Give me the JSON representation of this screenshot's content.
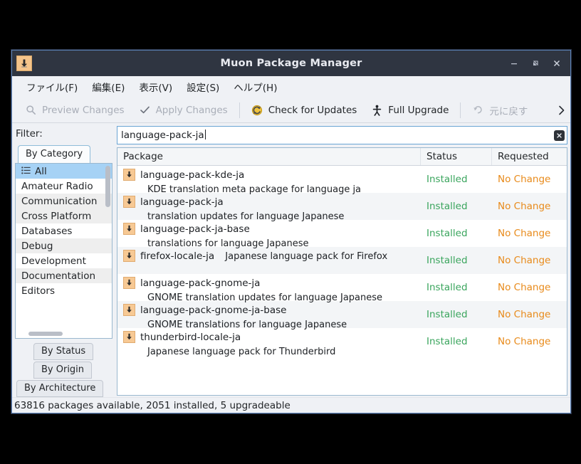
{
  "window": {
    "title": "Muon Package Manager",
    "app_icon": "download-arrow-icon",
    "controls": {
      "minimize": "minimize-icon",
      "maximize": "restore-icon",
      "close": "close-icon"
    }
  },
  "menubar": {
    "items": [
      {
        "label": "ファイル(F)",
        "name": "menu-file"
      },
      {
        "label": "編集(E)",
        "name": "menu-edit"
      },
      {
        "label": "表示(V)",
        "name": "menu-view"
      },
      {
        "label": "設定(S)",
        "name": "menu-settings"
      },
      {
        "label": "ヘルプ(H)",
        "name": "menu-help"
      }
    ]
  },
  "toolbar": {
    "preview_changes": "Preview Changes",
    "apply_changes": "Apply Changes",
    "check_for_updates": "Check for Updates",
    "full_upgrade": "Full Upgrade",
    "undo": "元に戻す",
    "overflow": "›"
  },
  "sidebar": {
    "filter_label": "Filter:",
    "tab_by_category": "By Category",
    "categories": [
      "All",
      "Amateur Radio",
      "Communication",
      "Cross Platform",
      "Databases",
      "Debug",
      "Development",
      "Documentation",
      "Editors"
    ],
    "selected_category": "All",
    "bottom_tabs": [
      "By Status",
      "By Origin",
      "By Architecture"
    ]
  },
  "search": {
    "value": "language-pack-ja",
    "placeholder": "Search",
    "clear_label": "×"
  },
  "table": {
    "columns": [
      "Package",
      "Status",
      "Requested"
    ],
    "rows": [
      {
        "name": "language-pack-kde-ja",
        "description": "KDE translation meta package for language ja",
        "status": "Installed",
        "requested": "No Change"
      },
      {
        "name": "language-pack-ja",
        "description": "translation updates for language Japanese",
        "status": "Installed",
        "requested": "No Change"
      },
      {
        "name": "language-pack-ja-base",
        "description": "translations for language Japanese",
        "status": "Installed",
        "requested": "No Change"
      },
      {
        "name": "firefox-locale-ja",
        "description": "Japanese language pack for Firefox",
        "status": "Installed",
        "requested": "No Change"
      },
      {
        "name": "language-pack-gnome-ja",
        "description": "GNOME translation updates for language Japanese",
        "status": "Installed",
        "requested": "No Change"
      },
      {
        "name": "language-pack-gnome-ja-base",
        "description": "GNOME translations for language Japanese",
        "status": "Installed",
        "requested": "No Change"
      },
      {
        "name": "thunderbird-locale-ja",
        "description": "Japanese language pack for Thunderbird",
        "status": "Installed",
        "requested": "No Change"
      }
    ]
  },
  "statusbar": {
    "text": "63816 packages available, 2051 installed, 5 upgradeable"
  },
  "colors": {
    "titlebar": "#2f3541",
    "chrome": "#eff1f5",
    "status_installed": "#3aa55d",
    "requested_nochange": "#e88a1a",
    "selection": "#a6d2f5",
    "package_icon": "#f7c994",
    "window_border": "#5a82b8"
  }
}
